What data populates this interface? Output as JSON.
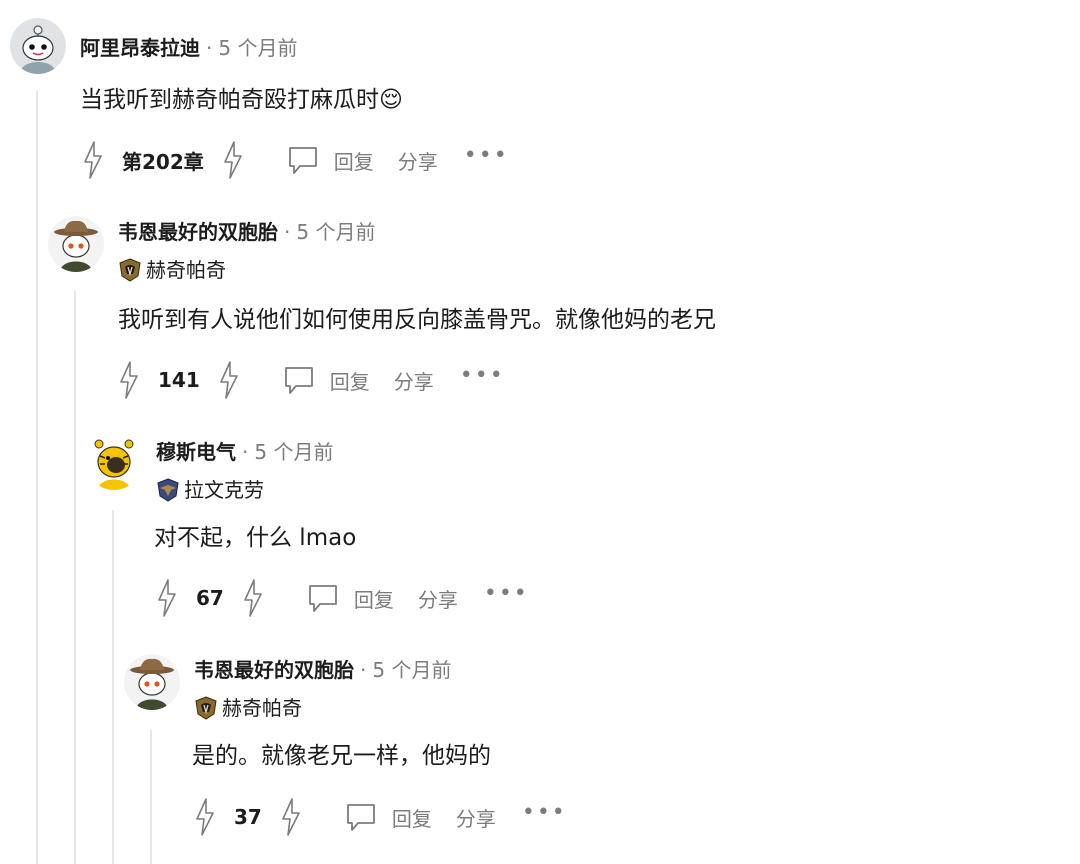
{
  "comments": [
    {
      "username": "阿里昂泰拉迪",
      "separator": "·",
      "time": "5 个月前",
      "flair": "",
      "body": "当我听到赫奇帕奇殴打麻瓜时😌",
      "score": "第202章",
      "reply_label": "回复",
      "share_label": "分享",
      "more_label": "•••"
    },
    {
      "username": "韦恩最好的双胞胎",
      "separator": "·",
      "time": "5 个月前",
      "flair": "赫奇帕奇",
      "body": "我听到有人说他们如何使用反向膝盖骨咒。就像他妈的老兄",
      "score": "141",
      "reply_label": "回复",
      "share_label": "分享",
      "more_label": "•••"
    },
    {
      "username": "穆斯电气",
      "separator": "·",
      "time": "5 个月前",
      "flair": "拉文克劳",
      "body": "对不起，什么 lmao",
      "score": "67",
      "reply_label": "回复",
      "share_label": "分享",
      "more_label": "•••"
    },
    {
      "username": "韦恩最好的双胞胎",
      "separator": "·",
      "time": "5 个月前",
      "flair": "赫奇帕奇",
      "body": "是的。就像老兄一样，他妈的",
      "score": "37",
      "reply_label": "回复",
      "share_label": "分享",
      "more_label": "•••"
    }
  ],
  "colors": {
    "text_primary": "#1c1c1c",
    "text_meta": "#7c7c7c",
    "thread_line": "#e6e6e6",
    "hufflepuff_flair": "#8a6a2e",
    "ravenclaw_flair": "#3b4a7a"
  },
  "icons": {
    "upvote": "upvote-icon",
    "downvote": "downvote-icon",
    "reply": "speech-bubble-icon",
    "more": "ellipsis-icon",
    "hufflepuff_flair": "badger-crest-icon",
    "ravenclaw_flair": "eagle-crest-icon"
  }
}
